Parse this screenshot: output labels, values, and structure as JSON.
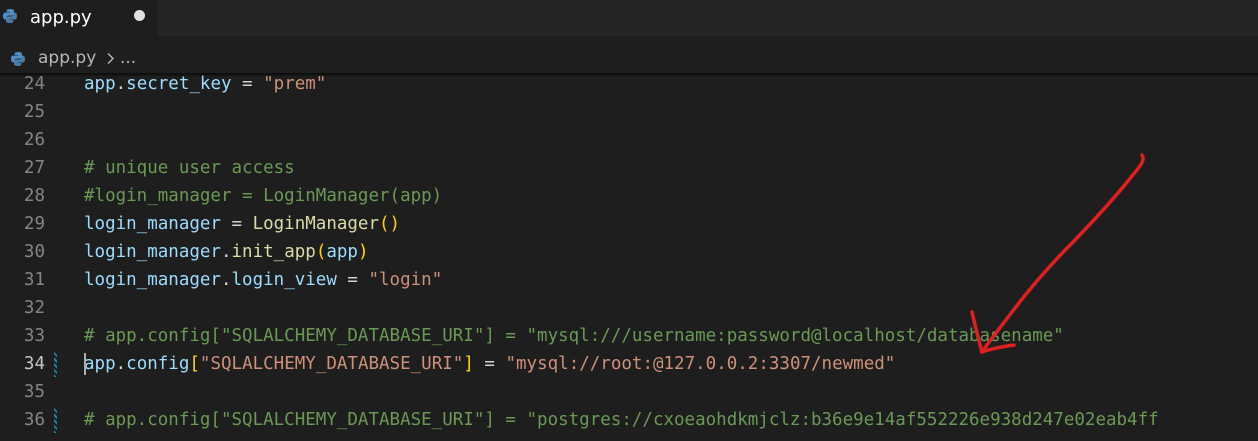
{
  "tab": {
    "title": "app.py",
    "icon": "python-icon",
    "modified": true
  },
  "breadcrumb": {
    "file": "app.py",
    "separator_icon": "chevron-right-icon",
    "ellipsis": "..."
  },
  "editor": {
    "active_line": "34",
    "lines": [
      {
        "number": "24",
        "parts": [
          {
            "t": "app",
            "c": "var"
          },
          {
            "t": ".",
            "c": "pn"
          },
          {
            "t": "secret_key",
            "c": "var"
          },
          {
            "t": " = ",
            "c": "pn"
          },
          {
            "t": "\"prem\"",
            "c": "str"
          }
        ]
      },
      {
        "number": "25",
        "parts": []
      },
      {
        "number": "26",
        "parts": []
      },
      {
        "number": "27",
        "parts": [
          {
            "t": "# unique user access",
            "c": "cm"
          }
        ]
      },
      {
        "number": "28",
        "parts": [
          {
            "t": "#login_manager = LoginManager(app)",
            "c": "cm"
          }
        ]
      },
      {
        "number": "29",
        "parts": [
          {
            "t": "login_manager",
            "c": "var"
          },
          {
            "t": " = ",
            "c": "pn"
          },
          {
            "t": "LoginManager",
            "c": "fn"
          },
          {
            "t": "()",
            "c": "br"
          }
        ]
      },
      {
        "number": "30",
        "parts": [
          {
            "t": "login_manager",
            "c": "var"
          },
          {
            "t": ".",
            "c": "pn"
          },
          {
            "t": "init_app",
            "c": "fn"
          },
          {
            "t": "(",
            "c": "br"
          },
          {
            "t": "app",
            "c": "var"
          },
          {
            "t": ")",
            "c": "br"
          }
        ]
      },
      {
        "number": "31",
        "parts": [
          {
            "t": "login_manager",
            "c": "var"
          },
          {
            "t": ".",
            "c": "pn"
          },
          {
            "t": "login_view",
            "c": "var"
          },
          {
            "t": " = ",
            "c": "pn"
          },
          {
            "t": "\"login\"",
            "c": "str"
          }
        ]
      },
      {
        "number": "32",
        "parts": []
      },
      {
        "number": "33",
        "parts": [
          {
            "t": "# app.config[\"SQLALCHEMY_DATABASE_URI\"] = \"mysql:///username:password@localhost/databasename\"",
            "c": "cm"
          }
        ]
      },
      {
        "number": "34",
        "parts": [
          {
            "t": "app",
            "c": "var"
          },
          {
            "t": ".",
            "c": "pn"
          },
          {
            "t": "config",
            "c": "var"
          },
          {
            "t": "[",
            "c": "br"
          },
          {
            "t": "\"SQLALCHEMY_DATABASE_URI\"",
            "c": "str"
          },
          {
            "t": "]",
            "c": "br"
          },
          {
            "t": " = ",
            "c": "pn"
          },
          {
            "t": "\"mysql://root:@127.0.0.2:3307/newmed\"",
            "c": "str"
          }
        ]
      },
      {
        "number": "35",
        "parts": []
      },
      {
        "number": "36",
        "parts": [
          {
            "t": "# app.config[\"SQLALCHEMY_DATABASE_URI\"] = \"postgres://cxoeaohdkmjclz:b36e9e14af552226e938d247e02eab4ff",
            "c": "cm"
          }
        ]
      }
    ],
    "modified_lines": [
      "34",
      "36"
    ]
  },
  "annotation": {
    "shape": "hand-drawn-arrow",
    "color": "#e02020"
  },
  "colors": {
    "background": "#1e1e1e",
    "variable": "#9cdcfe",
    "function": "#dcdcaa",
    "string": "#ce9178",
    "comment": "#6a9955",
    "bracket": "#ffd700"
  }
}
